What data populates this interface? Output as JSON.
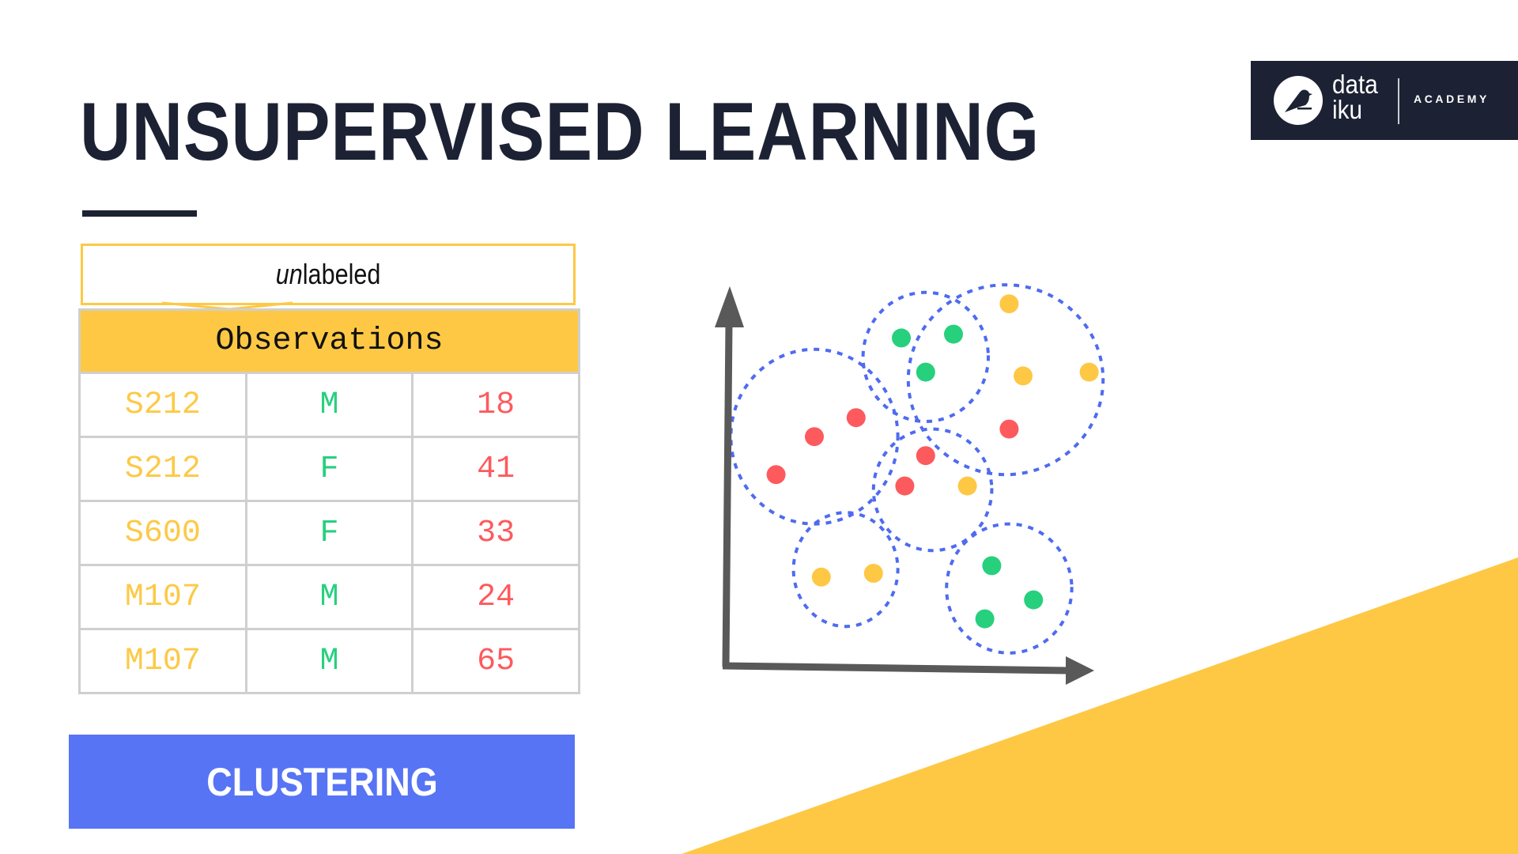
{
  "title": "UNSUPERVISED LEARNING",
  "logo": {
    "wordmark_line1": "data",
    "wordmark_line2": "iku",
    "academy": "ACADEMY",
    "icon": "bird-icon"
  },
  "label_box": {
    "prefix_italic": "un",
    "suffix": "labeled"
  },
  "table": {
    "header": "Observations",
    "rows": [
      [
        "S212",
        "M",
        "18"
      ],
      [
        "S212",
        "F",
        "41"
      ],
      [
        "S600",
        "F",
        "33"
      ],
      [
        "M107",
        "M",
        "24"
      ],
      [
        "M107",
        "M",
        "65"
      ]
    ],
    "column_colors": [
      "#fdc945",
      "#27d07d",
      "#fd5a5e"
    ]
  },
  "button": {
    "label": "CLUSTERING",
    "color": "#5774f5"
  },
  "colors": {
    "title": "#1c2233",
    "accent_yellow": "#fec845",
    "dot_red": "#fd5a5e",
    "dot_green": "#27d07d",
    "dot_yellow": "#fec845",
    "cluster_outline": "#4e6bf0",
    "axis": "#595959"
  },
  "chart_data": {
    "type": "scatter",
    "title": "",
    "xlabel": "",
    "ylabel": "",
    "grid": false,
    "axes_arrows": true,
    "xlim": [
      0,
      100
    ],
    "ylim": [
      0,
      100
    ],
    "points": [
      {
        "x": 14,
        "y": 51,
        "color": "red"
      },
      {
        "x": 25,
        "y": 61,
        "color": "red"
      },
      {
        "x": 37,
        "y": 66,
        "color": "red"
      },
      {
        "x": 50,
        "y": 87,
        "color": "green"
      },
      {
        "x": 65,
        "y": 88,
        "color": "green"
      },
      {
        "x": 57,
        "y": 78,
        "color": "green"
      },
      {
        "x": 81,
        "y": 96,
        "color": "yellow"
      },
      {
        "x": 85,
        "y": 77,
        "color": "yellow"
      },
      {
        "x": 104,
        "y": 78,
        "color": "yellow"
      },
      {
        "x": 81,
        "y": 63,
        "color": "red"
      },
      {
        "x": 57,
        "y": 56,
        "color": "red"
      },
      {
        "x": 51,
        "y": 48,
        "color": "red"
      },
      {
        "x": 69,
        "y": 48,
        "color": "yellow"
      },
      {
        "x": 27,
        "y": 24,
        "color": "yellow"
      },
      {
        "x": 42,
        "y": 25,
        "color": "yellow"
      },
      {
        "x": 76,
        "y": 27,
        "color": "green"
      },
      {
        "x": 88,
        "y": 18,
        "color": "green"
      },
      {
        "x": 74,
        "y": 13,
        "color": "green"
      }
    ],
    "clusters": [
      {
        "cx": 25,
        "cy": 61,
        "rx": 24,
        "ry": 23
      },
      {
        "cx": 57,
        "cy": 82,
        "rx": 18,
        "ry": 17
      },
      {
        "cx": 80,
        "cy": 76,
        "rx": 28,
        "ry": 25
      },
      {
        "cx": 59,
        "cy": 47,
        "rx": 17,
        "ry": 16
      },
      {
        "cx": 34,
        "cy": 26,
        "rx": 15,
        "ry": 15
      },
      {
        "cx": 81,
        "cy": 21,
        "rx": 18,
        "ry": 17
      }
    ]
  }
}
